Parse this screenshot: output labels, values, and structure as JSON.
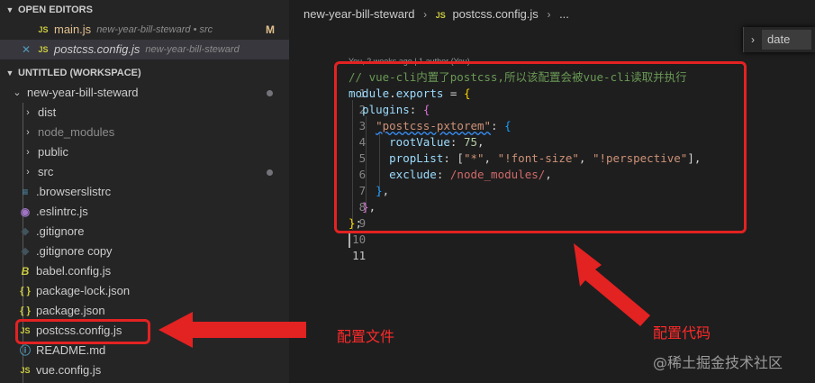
{
  "sidebar": {
    "open_editors_title": "OPEN EDITORS",
    "open_editors": [
      {
        "name": "main.js",
        "detail": "new-year-bill-steward • src",
        "badge": "M",
        "icon": "js-icon"
      },
      {
        "name": "postcss.config.js",
        "detail": "new-year-bill-steward",
        "icon": "js-icon"
      }
    ],
    "workspace_title": "UNTITLED (WORKSPACE)",
    "project_folder": "new-year-bill-steward",
    "tree": [
      {
        "name": "dist",
        "type": "folder"
      },
      {
        "name": "node_modules",
        "type": "folder"
      },
      {
        "name": "public",
        "type": "folder"
      },
      {
        "name": "src",
        "type": "folder"
      },
      {
        "name": ".browserslistrc",
        "type": "file",
        "icon": "rc-icon"
      },
      {
        "name": ".eslintrc.js",
        "type": "file",
        "icon": "gear-icon"
      },
      {
        "name": ".gitignore",
        "type": "file",
        "icon": "gitignore-icon"
      },
      {
        "name": ".gitignore copy",
        "type": "file",
        "icon": "gitignore-icon"
      },
      {
        "name": "babel.config.js",
        "type": "file",
        "icon": "babel-icon"
      },
      {
        "name": "package-lock.json",
        "type": "file",
        "icon": "json-icon"
      },
      {
        "name": "package.json",
        "type": "file",
        "icon": "json-icon"
      },
      {
        "name": "postcss.config.js",
        "type": "file",
        "icon": "js-icon"
      },
      {
        "name": "README.md",
        "type": "file",
        "icon": "info-icon"
      },
      {
        "name": "vue.config.js",
        "type": "file",
        "icon": "js-icon"
      }
    ]
  },
  "icons": {
    "js_glyph": "JS",
    "json_glyph": "{ }",
    "chevron_down": "⌄",
    "chevron_right": "›",
    "close_glyph": "✕"
  },
  "editor": {
    "breadcrumb": [
      "new-year-bill-steward",
      "postcss.config.js",
      "..."
    ],
    "find_value": "date",
    "codelens": "You, 2 weeks ago | 1 author (You)",
    "line_numbers": [
      "1",
      "2",
      "3",
      "4",
      "5",
      "6",
      "7",
      "8",
      "9",
      "10",
      "11"
    ],
    "code": {
      "l1_comment": "// vue-cli内置了postcss,所以该配置会被vue-cli读取并执行",
      "l2_a": "module",
      "l2_b": ".",
      "l2_c": "exports",
      "l2_d": " = ",
      "l2_e": "{",
      "l3_a": "plugins",
      "l3_b": ": ",
      "l3_c": "{",
      "l4_a": "\"postcss-pxtorem\"",
      "l4_b": ": ",
      "l4_c": "{",
      "l5_a": "rootValue",
      "l5_b": ": ",
      "l5_c": "75",
      "l5_d": ",",
      "l6_a": "propList",
      "l6_b": ": [",
      "l6_c": "\"*\"",
      "l6_d": ", ",
      "l6_e": "\"!font-size\"",
      "l6_f": ", ",
      "l6_g": "\"!perspective\"",
      "l6_h": "],",
      "l7_a": "exclude",
      "l7_b": ": ",
      "l7_c": "/node_modules/",
      "l7_d": ",",
      "l8_a": "}",
      "l8_b": ",",
      "l9_a": "}",
      "l9_b": ",",
      "l10_a": "}",
      "l10_b": ";"
    }
  },
  "annotations": {
    "config_file_label": "配置文件",
    "config_code_label": "配置代码",
    "watermark": "@稀土掘金技术社区",
    "color": "#e32222"
  }
}
